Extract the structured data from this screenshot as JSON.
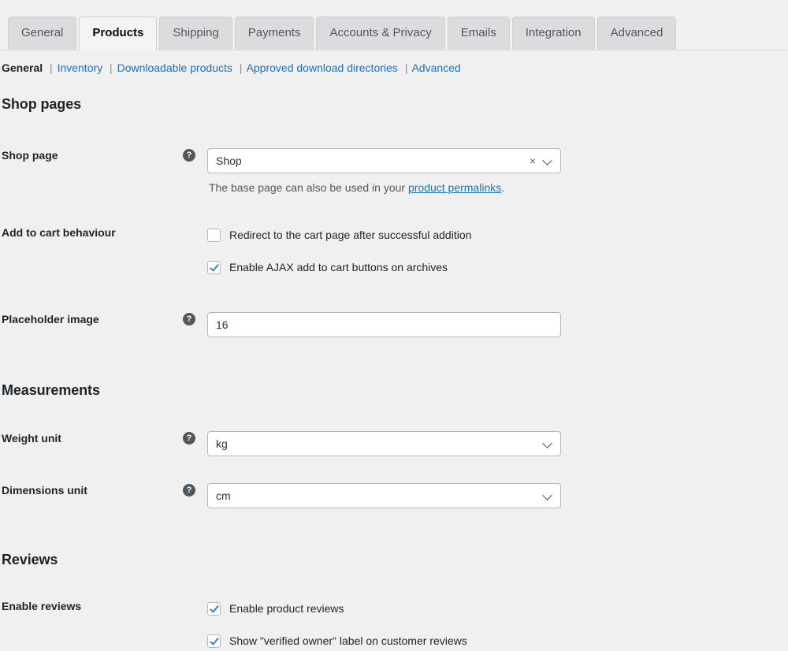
{
  "tabs": [
    {
      "label": "General",
      "active": false
    },
    {
      "label": "Products",
      "active": true
    },
    {
      "label": "Shipping",
      "active": false
    },
    {
      "label": "Payments",
      "active": false
    },
    {
      "label": "Accounts & Privacy",
      "active": false
    },
    {
      "label": "Emails",
      "active": false
    },
    {
      "label": "Integration",
      "active": false
    },
    {
      "label": "Advanced",
      "active": false
    }
  ],
  "subnav": {
    "items": [
      {
        "label": "General",
        "current": true
      },
      {
        "label": "Inventory",
        "current": false
      },
      {
        "label": "Downloadable products",
        "current": false
      },
      {
        "label": "Approved download directories",
        "current": false
      },
      {
        "label": "Advanced",
        "current": false
      }
    ],
    "separator": "|"
  },
  "sections": {
    "shop_pages": {
      "title": "Shop pages",
      "shop_page": {
        "label": "Shop page",
        "help_icon": "question-mark-icon",
        "value": "Shop",
        "clear_icon": "×",
        "chevron_icon": "chevron-down-icon",
        "description_before": "The base page can also be used in your ",
        "description_link": "product permalinks",
        "description_after": "."
      },
      "add_to_cart": {
        "label": "Add to cart behaviour",
        "options": [
          {
            "label": "Redirect to the cart page after successful addition",
            "checked": false
          },
          {
            "label": "Enable AJAX add to cart buttons on archives",
            "checked": true
          }
        ]
      },
      "placeholder_image": {
        "label": "Placeholder image",
        "help_icon": "question-mark-icon",
        "value": "16",
        "placeholder": ""
      }
    },
    "measurements": {
      "title": "Measurements",
      "weight_unit": {
        "label": "Weight unit",
        "help_icon": "question-mark-icon",
        "value": "kg",
        "chevron_icon": "chevron-down-icon"
      },
      "dimensions_unit": {
        "label": "Dimensions unit",
        "help_icon": "question-mark-icon",
        "value": "cm",
        "chevron_icon": "chevron-down-icon"
      }
    },
    "reviews": {
      "title": "Reviews",
      "enable_reviews": {
        "label": "Enable reviews",
        "options": [
          {
            "label": "Enable product reviews",
            "checked": true
          },
          {
            "label": "Show \"verified owner\" label on customer reviews",
            "checked": true
          }
        ]
      }
    }
  },
  "colors": {
    "page_bg": "#f0f0f1",
    "link": "#2271b1",
    "checkbox_check": "#3582c4",
    "tab_inactive_bg": "#dcdcde",
    "tab_active_bg": "#f4f4f5"
  }
}
